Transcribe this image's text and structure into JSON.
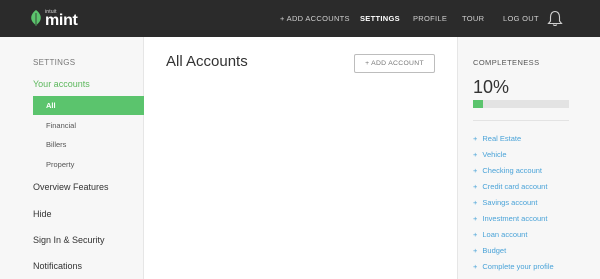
{
  "brand": {
    "small": "intuit",
    "name": "mint"
  },
  "nav": {
    "add_accounts": "+ ADD ACCOUNTS",
    "settings": "SETTINGS",
    "profile": "PROFILE",
    "tour": "TOUR",
    "logout": "LOG OUT"
  },
  "sidebar": {
    "heading": "SETTINGS",
    "accounts": "Your accounts",
    "sub_items": [
      "All",
      "Financial",
      "Billers",
      "Property"
    ],
    "main_items": [
      "Overview Features",
      "Hide",
      "Sign In & Security",
      "Notifications"
    ]
  },
  "main": {
    "title": "All Accounts",
    "add_button": "+ ADD ACCOUNT"
  },
  "completeness": {
    "heading": "COMPLETENESS",
    "percent_label": "10%",
    "progress_fraction": 0.1,
    "items": [
      "Real Estate",
      "Vehicle",
      "Checking account",
      "Credit card account",
      "Savings account",
      "Investment account",
      "Loan account",
      "Budget",
      "Complete your profile"
    ]
  },
  "colors": {
    "accent_green": "#5bc46d",
    "link_blue": "#4aa3d8",
    "topbar": "#2b2b2b"
  }
}
